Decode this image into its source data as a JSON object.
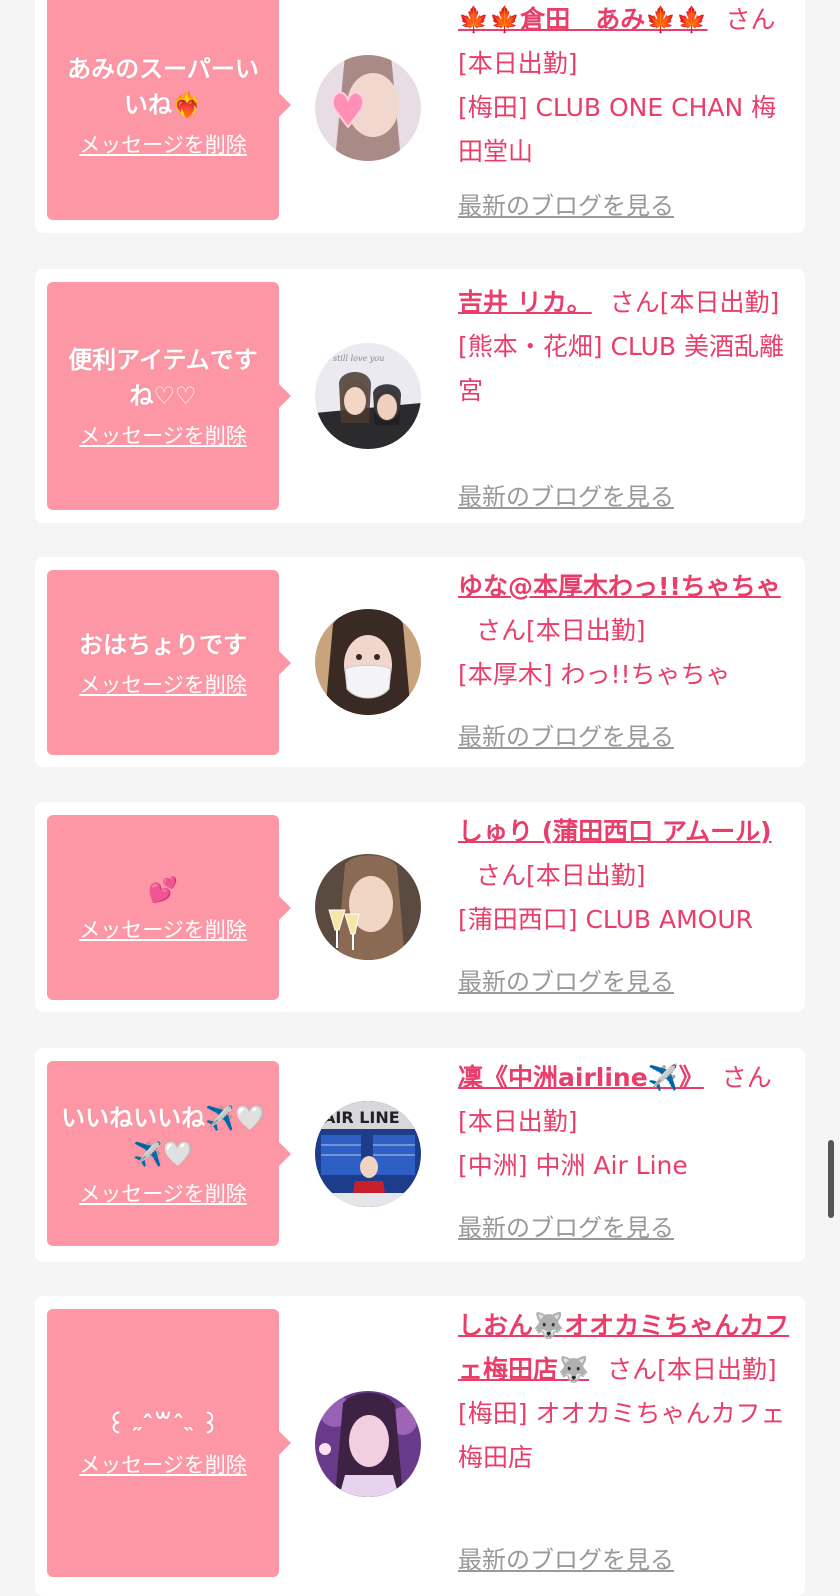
{
  "messages": [
    {
      "message": "あみのスーパーいいね❤️‍🔥",
      "delete_label": "メッセージを削除",
      "name": "🍁🍁倉田　あみ🍁🍁",
      "honorific": "さん",
      "status": "[本日出勤]",
      "shop": "[梅田] CLUB ONE CHAN 梅田堂山",
      "blog_label": "最新のブログを見る",
      "avatar_icon": "woman-with-heart-sticker"
    },
    {
      "message": "便利アイテムですね♡♡",
      "delete_label": "メッセージを削除",
      "name": "吉井 リカ。",
      "honorific": "さん",
      "status": "[本日出勤]",
      "shop": "[熊本・花畑] CLUB 美酒乱離宮",
      "blog_label": "最新のブログを見る",
      "avatar_icon": "two-women-selfie"
    },
    {
      "message": "おはちょりです",
      "delete_label": "メッセージを削除",
      "name": "ゆな@本厚木わっ!!ちゃちゃ",
      "honorific": "さん",
      "status": "[本日出勤]",
      "shop": "[本厚木] わっ!!ちゃちゃ",
      "blog_label": "最新のブログを見る",
      "avatar_icon": "woman-with-mask"
    },
    {
      "message": "💕",
      "delete_label": "メッセージを削除",
      "name": "しゅり (蒲田西口 アムール)",
      "honorific": "さん",
      "status": "[本日出勤]",
      "shop": "[蒲田西口] CLUB AMOUR",
      "blog_label": "最新のブログを見る",
      "avatar_icon": "woman-with-champagne"
    },
    {
      "message": "いいねいいね✈️🤍✈️🤍",
      "delete_label": "メッセージを削除",
      "name": "凜《中洲airline✈️》",
      "honorific": "さん",
      "status": "[本日出勤]",
      "shop": "[中洲] 中洲 Air Line",
      "blog_label": "最新のブログを見る",
      "avatar_icon": "airport-departure-board"
    },
    {
      "message": "꒰ ˶ˆ꒳ˆ˵ ꒱",
      "delete_label": "メッセージを削除",
      "name": "しおん🐺オオカミちゃんカフェ梅田店🐺",
      "honorific": "さん",
      "status": "[本日出勤]",
      "shop": "[梅田] オオカミちゃんカフェ梅田店",
      "blog_label": "最新のブログを見る",
      "avatar_icon": "woman-purple-lighting"
    }
  ]
}
